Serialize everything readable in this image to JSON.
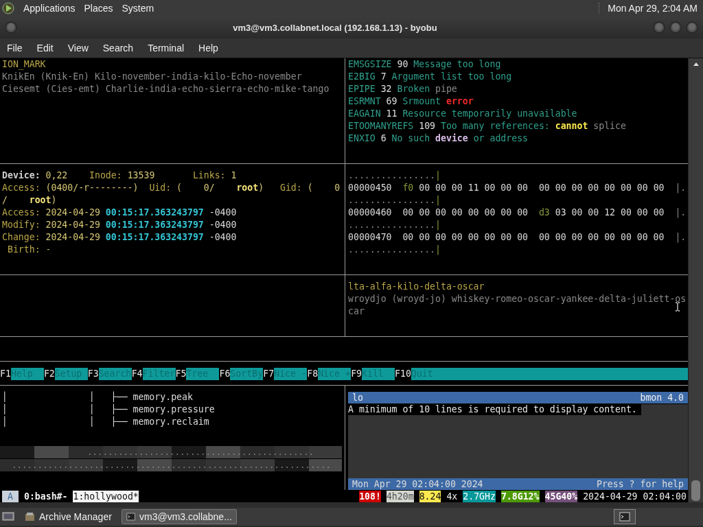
{
  "top_panel": {
    "menus": [
      "Applications",
      "Places",
      "System"
    ],
    "clock": "Mon Apr 29, 2:04 AM"
  },
  "window": {
    "title": "vm3@vm3.collabnet.local (192.168.1.13) - byobu",
    "menu": [
      "File",
      "Edit",
      "View",
      "Search",
      "Terminal",
      "Help"
    ]
  },
  "terminal": {
    "top_left": {
      "lines": [
        [
          {
            "text": "ION_MARK",
            "kind": "label"
          }
        ],
        [
          {
            "text": "KnikEn (Knik-En) Kilo-november-india-kilo-Echo-november",
            "kind": "dim"
          }
        ],
        [
          {
            "text": "Ciesemt (Cies-emt) Charlie-india-echo-sierra-echo-mike-tango",
            "kind": "dim"
          }
        ]
      ]
    },
    "top_right": {
      "lines": [
        [
          {
            "text": "EMSGSIZE",
            "kind": "code"
          },
          {
            "text": " 90 ",
            "kind": "num"
          },
          {
            "text": "Message too long",
            "kind": "desc"
          }
        ],
        [
          {
            "text": "E2BIG",
            "kind": "code"
          },
          {
            "text": " 7 ",
            "kind": "num"
          },
          {
            "text": "Argument list too long",
            "kind": "desc"
          }
        ],
        [
          {
            "text": "EPIPE",
            "kind": "code"
          },
          {
            "text": " 32 ",
            "kind": "num"
          },
          {
            "text": "Broken ",
            "kind": "desc"
          },
          {
            "text": "pipe",
            "kind": "dim"
          }
        ],
        [
          {
            "text": "ESRMNT",
            "kind": "code"
          },
          {
            "text": " 69 ",
            "kind": "num"
          },
          {
            "text": "Srmount ",
            "kind": "desc"
          },
          {
            "text": "error",
            "kind": "error"
          }
        ],
        [
          {
            "text": "EAGAIN",
            "kind": "code"
          },
          {
            "text": " 11 ",
            "kind": "num"
          },
          {
            "text": "Resource temporarily unavailable",
            "kind": "desc"
          }
        ],
        [
          {
            "text": "ETOOMANYREFS",
            "kind": "code"
          },
          {
            "text": " 109 ",
            "kind": "num"
          },
          {
            "text": "Too many references: ",
            "kind": "desc"
          },
          {
            "text": "cannot",
            "kind": "strong-yellow"
          },
          {
            "text": " splice",
            "kind": "dim"
          }
        ],
        [
          {
            "text": "ENXIO",
            "kind": "code"
          },
          {
            "text": " 6 ",
            "kind": "num"
          },
          {
            "text": "No such ",
            "kind": "desc"
          },
          {
            "text": "device",
            "kind": "strong-violet"
          },
          {
            "text": " or address",
            "kind": "desc"
          }
        ]
      ]
    },
    "middle_left": {
      "lines": [
        [
          {
            "text": "Device:",
            "kind": "strong"
          },
          {
            "text": " 0,22    ",
            "kind": "value"
          },
          {
            "text": "Inode:",
            "kind": "label"
          },
          {
            "text": " 13539       ",
            "kind": "value"
          },
          {
            "text": "Links:",
            "kind": "label"
          },
          {
            "text": " 1",
            "kind": "value"
          }
        ],
        [
          {
            "text": "Access:",
            "kind": "label"
          },
          {
            "text": " (0400/-r--------)  ",
            "kind": "value"
          },
          {
            "text": "Uid:",
            "kind": "label"
          },
          {
            "text": " (    0/    ",
            "kind": "value"
          },
          {
            "text": "root",
            "kind": "strong-gold"
          },
          {
            "text": ")   ",
            "kind": "value"
          },
          {
            "text": "Gid:",
            "kind": "label"
          },
          {
            "text": " (    0",
            "kind": "value"
          }
        ],
        [
          {
            "text": "/    ",
            "kind": "value"
          },
          {
            "text": "root",
            "kind": "strong-gold"
          },
          {
            "text": ")",
            "kind": "value"
          }
        ],
        [
          {
            "text": "Access:",
            "kind": "label"
          },
          {
            "text": " 2024-04-29 ",
            "kind": "value"
          },
          {
            "text": "00:15:17.363243797",
            "kind": "time"
          },
          {
            "text": " -0400",
            "kind": "plain"
          }
        ],
        [
          {
            "text": "Modify:",
            "kind": "label"
          },
          {
            "text": " 2024-04-29 ",
            "kind": "value"
          },
          {
            "text": "00:15:17.363243797",
            "kind": "time"
          },
          {
            "text": " -0400",
            "kind": "plain"
          }
        ],
        [
          {
            "text": "Change:",
            "kind": "label"
          },
          {
            "text": " 2024-04-29 ",
            "kind": "value"
          },
          {
            "text": "00:15:17.363243797",
            "kind": "time"
          },
          {
            "text": " -0400",
            "kind": "plain"
          }
        ],
        [
          {
            "text": " Birth: -",
            "kind": "label"
          }
        ]
      ]
    },
    "middle_right": {
      "lines": [
        [
          {
            "text": "................",
            "kind": "dim"
          },
          {
            "text": "|",
            "kind": "hex-hi"
          }
        ],
        [
          {
            "text": "00000450  ",
            "kind": "plain"
          },
          {
            "text": "f0",
            "kind": "hex-hi"
          },
          {
            "text": " 00 00 00 11 00 00 00  00 00 00 00 00 00 00 00  ",
            "kind": "plain"
          },
          {
            "text": "|.",
            "kind": "dim"
          }
        ],
        [
          {
            "text": "................",
            "kind": "dim"
          },
          {
            "text": "|",
            "kind": "hex-hi"
          }
        ],
        [
          {
            "text": "00000460  00 00 00 00 00 00 00 00  ",
            "kind": "plain"
          },
          {
            "text": "d3",
            "kind": "hex-hi"
          },
          {
            "text": " 03 00 00 12 00 00 00  ",
            "kind": "plain"
          },
          {
            "text": "|.",
            "kind": "dim"
          }
        ],
        [
          {
            "text": "................",
            "kind": "dim"
          },
          {
            "text": "|",
            "kind": "hex-hi"
          }
        ],
        [
          {
            "text": "00000470  00 00 00 00 00 00 00 00  00 00 00 00 00 00 00 00  ",
            "kind": "plain"
          },
          {
            "text": "|.",
            "kind": "dim"
          }
        ],
        [
          {
            "text": "................",
            "kind": "dim"
          },
          {
            "text": "|",
            "kind": "hex-hi"
          }
        ]
      ]
    },
    "lower_right": {
      "lines": [
        [
          {
            "text": "lta-alfa-kilo-delta-oscar",
            "kind": "label"
          }
        ],
        [
          {
            "text": "wroydjo (wroyd-jo) whiskey-romeo-oscar-yankee-delta-juliett-os",
            "kind": "dim"
          }
        ],
        [
          {
            "text": "car",
            "kind": "dim"
          }
        ]
      ]
    },
    "function_keys": [
      {
        "key": "F1",
        "label": "Help"
      },
      {
        "key": "F2",
        "label": "Setup"
      },
      {
        "key": "F3",
        "label": "Search"
      },
      {
        "key": "F4",
        "label": "Filter"
      },
      {
        "key": "F5",
        "label": "Tree"
      },
      {
        "key": "F6",
        "label": "SortBy"
      },
      {
        "key": "F7",
        "label": "Nice -"
      },
      {
        "key": "F8",
        "label": "Nice +"
      },
      {
        "key": "F9",
        "label": "Kill"
      },
      {
        "key": "F10",
        "label": "Quit"
      }
    ],
    "tree": [
      "│               │   ├── memory.peak",
      "│               │   ├── memory.pressure",
      "│               │   ├── memory.reclaim"
    ],
    "bmon": {
      "interface": "lo",
      "version": "bmon 4.0",
      "message": "A minimum of 10 lines is required to display content.",
      "date": "Mon Apr 29 02:04:00 2024",
      "help": "Press ? for help"
    }
  },
  "status_bar": {
    "mode": "A",
    "windows": [
      {
        "label": "0:bash#-",
        "selected": false
      },
      {
        "label": "1:hollywood*",
        "selected": true
      }
    ],
    "stats": [
      {
        "text": "108!",
        "kind": "alert"
      },
      {
        "text": "4h20m",
        "kind": "uptime"
      },
      {
        "text": "8.24",
        "kind": "load"
      },
      {
        "text": "4x",
        "kind": "plain"
      },
      {
        "text": "2.7GHz",
        "kind": "cpu"
      },
      {
        "text": "7.8G12%",
        "kind": "memory"
      },
      {
        "text": "45G40%",
        "kind": "disk"
      },
      {
        "text": "2024-04-29 02:04:00",
        "kind": "plain"
      }
    ]
  },
  "taskbar": {
    "tasks": [
      {
        "label": "Archive Manager",
        "selected": false
      },
      {
        "label": "vm3@vm3.collabne...",
        "selected": true
      }
    ]
  }
}
